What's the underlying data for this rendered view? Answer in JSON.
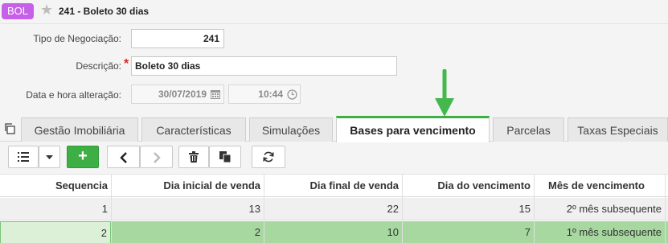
{
  "header": {
    "badge": "BOL",
    "title": "241 - Boleto 30 dias"
  },
  "form": {
    "tipo_label": "Tipo de Negociação:",
    "tipo_value": "241",
    "descricao_label": "Descrição:",
    "descricao_required": "*",
    "descricao_value": "Boleto 30 dias",
    "data_label": "Data e hora alteração:",
    "data_value": "30/07/2019",
    "hora_value": "10:44"
  },
  "tabs": [
    {
      "label": "Gestão Imobiliária"
    },
    {
      "label": "Características"
    },
    {
      "label": "Simulações"
    },
    {
      "label": "Bases para vencimento"
    },
    {
      "label": "Parcelas"
    },
    {
      "label": "Taxas Especiais"
    }
  ],
  "active_tab": "Bases para vencimento",
  "toolbar": {
    "add_label": "+"
  },
  "grid": {
    "columns": [
      "Sequencia",
      "Dia inicial de venda",
      "Dia final de venda",
      "Dia do vencimento",
      "Mês de vencimento"
    ],
    "rows": [
      [
        "1",
        "13",
        "22",
        "15",
        "2º mês subsequente"
      ],
      [
        "2",
        "2",
        "10",
        "7",
        "1º mês subsequente"
      ]
    ]
  },
  "colors": {
    "badge": "#c660e8",
    "accent_green": "#3daf45",
    "selected_row": "#a6d8a0",
    "required": "#d9261c"
  },
  "icons": [
    "star-icon",
    "calendar-icon",
    "clock-icon",
    "copy-icon",
    "list-icon",
    "chevron-down-icon",
    "add-icon",
    "chevron-left-icon",
    "chevron-right-icon",
    "trash-icon",
    "duplicate-icon",
    "refresh-icon",
    "arrow-down-icon"
  ]
}
